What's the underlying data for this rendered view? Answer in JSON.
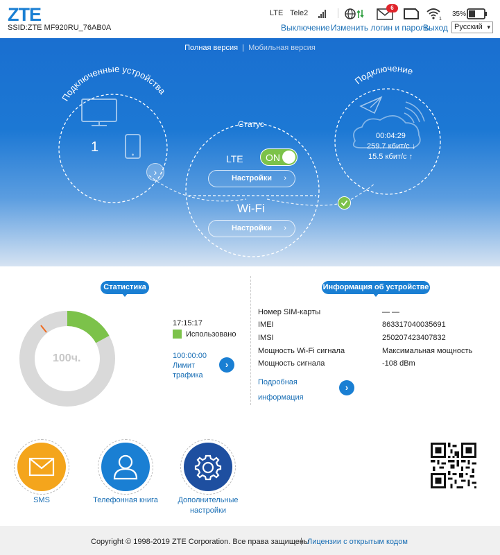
{
  "header": {
    "logo": "ZTE",
    "ssid": "SSID:ZTE MF920RU_76AB0A",
    "network_type": "LTE",
    "operator": "Tele2",
    "sms_unread": "6",
    "battery_percent": "35%",
    "links": {
      "shutdown": "Выключение",
      "change_login": "Изменить логин и пароль",
      "logout": "Выход"
    },
    "language": "Русский"
  },
  "hero": {
    "version_full": "Полная версия",
    "version_separator": "|",
    "version_mobile": "Мобильная версия",
    "devices_title": "Подключенные устройства",
    "devices_count": "1",
    "status_title": "Статус",
    "lte_label": "LTE",
    "lte_toggle": "ON",
    "settings_label": "Настройки",
    "wifi_label": "Wi-Fi",
    "wifi_settings_label": "Настройки",
    "connection_title": "Подключение",
    "connection_time": "00:04:29",
    "download_speed": "259.7 кбит/с ↓",
    "upload_speed": "15.5 кбит/с ↑"
  },
  "stats": {
    "title": "Статистика",
    "donut_center": "100ч.",
    "used_fraction": 0.17,
    "elapsed": "17:15:17",
    "used_label": "Использовано",
    "limit_value": "100:00:00",
    "limit_label_1": "Лимит",
    "limit_label_2": "трафика"
  },
  "device_info": {
    "title": "Информация об устройстве",
    "rows": [
      {
        "label": "Номер SIM-карты",
        "value": "— —"
      },
      {
        "label": "IMEI",
        "value": "863317040035691"
      },
      {
        "label": "IMSI",
        "value": "250207423407832"
      },
      {
        "label": "Мощность Wi-Fi сигнала",
        "value": "Максимальная мощность"
      },
      {
        "label": "Мощность сигнала",
        "value": "-108 dBm"
      }
    ],
    "more_1": "Подробная",
    "more_2": "информация"
  },
  "shortcuts": {
    "sms": "SMS",
    "phonebook": "Телефонная книга",
    "advanced_1": "Дополнительные",
    "advanced_2": "настройки"
  },
  "footer": {
    "copyright": "Copyright © 1998-2019 ZTE Corporation. Все права защищены",
    "separator": "|",
    "opensource": "Лицензии с открытым кодом"
  },
  "colors": {
    "brand_blue": "#1a7fd3",
    "accent_green": "#7cc24a",
    "sms_orange": "#f4a51c",
    "phonebook_blue": "#1a7fd3",
    "settings_navy": "#1e4fa0"
  }
}
